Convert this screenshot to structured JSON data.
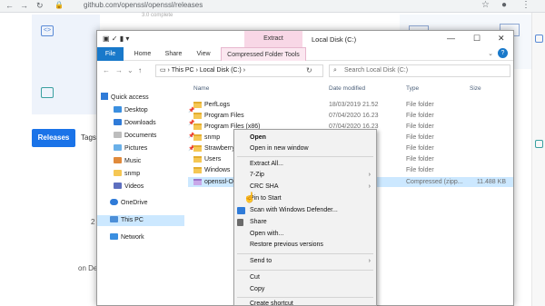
{
  "browser": {
    "url": "github.com/openssl/openssl/releases",
    "peek_text": "3.0 complete"
  },
  "page": {
    "releases_tab": "Releases",
    "tags_tab": "Tags",
    "snippet1": "2",
    "snippet2": "on De"
  },
  "explorer": {
    "title": "Local Disk (C:)",
    "context_tab": "Extract",
    "ribbon_tabs": [
      "File",
      "Home",
      "Share",
      "View",
      "Compressed Folder Tools"
    ],
    "address": [
      "This PC",
      "Local Disk (C:)"
    ],
    "search_placeholder": "Search Local Disk (C:)",
    "columns": {
      "name": "Name",
      "date": "Date modified",
      "type": "Type",
      "size": "Size"
    },
    "nav": {
      "quick_access": "Quick access",
      "items": [
        "Desktop",
        "Downloads",
        "Documents",
        "Pictures",
        "Music",
        "snmp",
        "Videos"
      ],
      "onedrive": "OneDrive",
      "this_pc": "This PC",
      "network": "Network"
    },
    "files": [
      {
        "name": "PerfLogs",
        "date": "18/03/2019 21.52",
        "type": "File folder",
        "size": ""
      },
      {
        "name": "Program Files",
        "date": "07/04/2020 16.23",
        "type": "File folder",
        "size": ""
      },
      {
        "name": "Program Files (x86)",
        "date": "07/04/2020 16.23",
        "type": "File folder",
        "size": ""
      },
      {
        "name": "snmp",
        "date": "",
        "type": "File folder",
        "size": ""
      },
      {
        "name": "Strawberry",
        "date": "",
        "type": "File folder",
        "size": ""
      },
      {
        "name": "Users",
        "date": "",
        "type": "File folder",
        "size": ""
      },
      {
        "name": "Windows",
        "date": "",
        "type": "File folder",
        "size": ""
      },
      {
        "name": "openssl-O",
        "date": "",
        "type": "Compressed (zipp...",
        "size": "11.488 KB"
      }
    ]
  },
  "context_menu": {
    "items": [
      {
        "label": "Open",
        "bold": true
      },
      {
        "label": "Open in new window"
      },
      {
        "sep": true
      },
      {
        "label": "Extract All..."
      },
      {
        "label": "7-Zip",
        "sub": true
      },
      {
        "label": "CRC SHA",
        "sub": true
      },
      {
        "label": "Pin to Start"
      },
      {
        "label": "Scan with Windows Defender..."
      },
      {
        "label": "Share"
      },
      {
        "label": "Open with..."
      },
      {
        "label": "Restore previous versions"
      },
      {
        "sep": true
      },
      {
        "label": "Send to",
        "sub": true
      },
      {
        "sep": true
      },
      {
        "label": "Cut"
      },
      {
        "label": "Copy"
      },
      {
        "sep": true
      },
      {
        "label": "Create shortcut"
      }
    ]
  },
  "colors": {
    "accent": "#1979ca",
    "selection": "#cce8ff",
    "context_tab": "#f8d7e6",
    "folder": "#f5c754"
  }
}
